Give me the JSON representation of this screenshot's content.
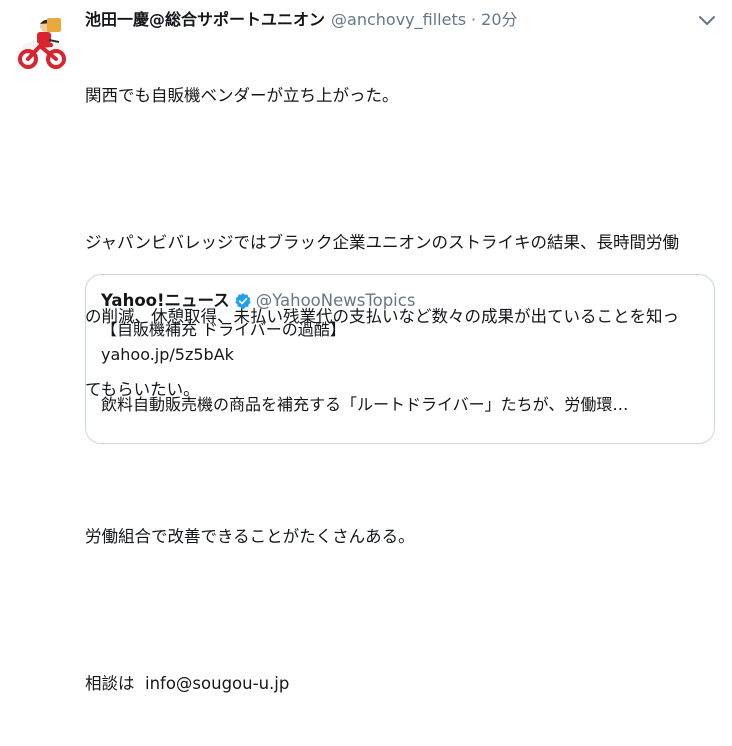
{
  "tweet": {
    "display_name": "池田一慶@総合サポートユニオン",
    "handle": "@anchovy_fillets",
    "separator": "·",
    "time": "20分",
    "lines": [
      "関西でも自販機ベンダーが立ち上がった。",
      "",
      "ジャパンビバレッジではブラック企業ユニオンのストライキの結果、長時間労働",
      "の削減、休憩取得、未払い残業代の支払いなど数々の成果が出ていることを知っ",
      "てもらいたい。",
      "",
      "労働組合で改善できることがたくさんある。",
      "",
      "相談は  info@sougou-u.jp"
    ],
    "menu_icon": "chevron-down-icon"
  },
  "quote": {
    "display_name": "Yahoo!ニュース",
    "verified_icon": "verified-badge-icon",
    "handle": "@YahooNewsTopics",
    "title": "【自販機補充 ドライバーの過酷】",
    "link": "yahoo.jp/5z5bAk",
    "excerpt": "飲料自動販売機の商品を補充する「ルートドライバー」たちが、労働環…"
  },
  "colors": {
    "text": "#14171a",
    "secondary": "#657786",
    "border": "#ccd6dd",
    "verified": "#1da1f2",
    "avatar_accent": "#d9232d"
  }
}
